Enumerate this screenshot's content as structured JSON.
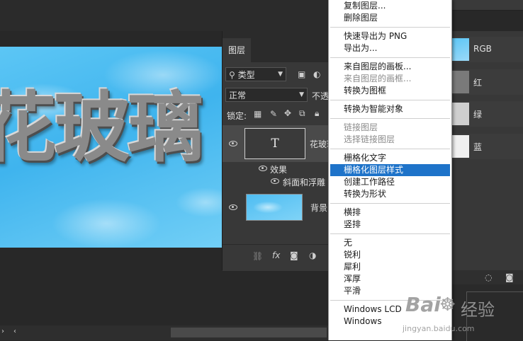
{
  "canvas": {
    "text": "花玻璃"
  },
  "layers_panel": {
    "tab": "图层",
    "filter_kind": "类型",
    "blend_mode": "正常",
    "opacity_label": "不透",
    "lock_label": "锁定:",
    "layers": [
      {
        "thumb": "T",
        "name": "花玻璃"
      },
      {
        "name": "效果"
      },
      {
        "name": "斜面和浮雕"
      },
      {
        "name": "背景"
      }
    ]
  },
  "context_menu": {
    "items": [
      {
        "label": "复制图层...",
        "disabled": false
      },
      {
        "label": "删除图层",
        "disabled": false
      },
      {
        "sep": true
      },
      {
        "label": "快速导出为 PNG",
        "disabled": false
      },
      {
        "label": "导出为...",
        "disabled": false
      },
      {
        "sep": true
      },
      {
        "label": "来自图层的画板...",
        "disabled": false
      },
      {
        "label": "来自图层的画框...",
        "disabled": true
      },
      {
        "label": "转换为图框",
        "disabled": false
      },
      {
        "sep": true
      },
      {
        "label": "转换为智能对象",
        "disabled": false
      },
      {
        "sep": true
      },
      {
        "label": "链接图层",
        "disabled": true
      },
      {
        "label": "选择链接图层",
        "disabled": true
      },
      {
        "sep": true
      },
      {
        "label": "栅格化文字",
        "disabled": false
      },
      {
        "label": "栅格化图层样式",
        "disabled": false,
        "selected": true
      },
      {
        "label": "创建工作路径",
        "disabled": false
      },
      {
        "label": "转换为形状",
        "disabled": false
      },
      {
        "sep": true
      },
      {
        "label": "横排",
        "disabled": false
      },
      {
        "label": "竖排",
        "disabled": false
      },
      {
        "sep": true
      },
      {
        "label": "无",
        "disabled": false
      },
      {
        "label": "锐利",
        "disabled": false
      },
      {
        "label": "犀利",
        "disabled": false
      },
      {
        "label": "浑厚",
        "disabled": false
      },
      {
        "label": "平滑",
        "disabled": false
      },
      {
        "sep": true
      },
      {
        "label": "Windows LCD",
        "disabled": false
      },
      {
        "label": "Windows",
        "disabled": false
      }
    ]
  },
  "channels": [
    {
      "name": "RGB"
    },
    {
      "name": "红"
    },
    {
      "name": "绿"
    },
    {
      "name": "蓝"
    }
  ],
  "watermark": {
    "brand": "Bai",
    "brand_suffix": "经验",
    "url": "jingyan.baidu.com"
  }
}
